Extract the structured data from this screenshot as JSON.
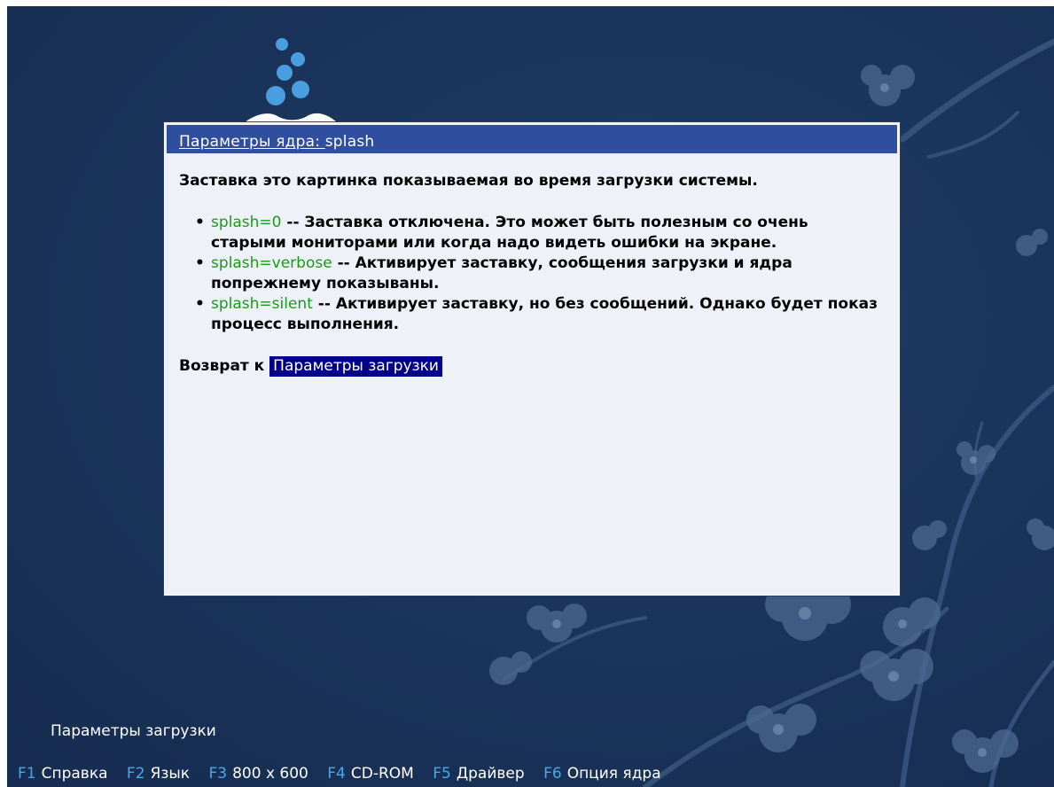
{
  "dialog": {
    "title_prefix": "Параметры ядра",
    "title_colon": ": ",
    "title_keyword": "splash",
    "intro": "Заставка это картинка показываемая во время загрузки системы.",
    "options": [
      {
        "keyword": "splash=0",
        "text": " -- Заставка отключена. Это может быть полезным со очень старыми мониторами или когда надо видеть ошибки на экране."
      },
      {
        "keyword": "splash=verbose",
        "text": " -- Активирует заставку, сообщения загрузки и ядра попрежнему показываны."
      },
      {
        "keyword": "splash=silent",
        "text": " -- Активирует заставку, но без сообщений. Однако будет показ процесс выполнения."
      }
    ],
    "back_prefix": "Возврат к",
    "back_link": "Параметры загрузки"
  },
  "boot_params_label": "Параметры загрузки",
  "function_keys": [
    {
      "key": "F1",
      "label": "Справка"
    },
    {
      "key": "F2",
      "label": "Язык"
    },
    {
      "key": "F3",
      "label": "800 x 600"
    },
    {
      "key": "F4",
      "label": "CD-ROM"
    },
    {
      "key": "F5",
      "label": "Драйвер"
    },
    {
      "key": "F6",
      "label": "Опция ядра"
    }
  ],
  "colors": {
    "background": "#1a335a",
    "title_bar": "#2f4e9e",
    "dialog_bg": "#eef2f8",
    "keyword_green": "#1a9a1a",
    "link_bg": "#00008a",
    "fkey_blue": "#4aa8e8"
  }
}
